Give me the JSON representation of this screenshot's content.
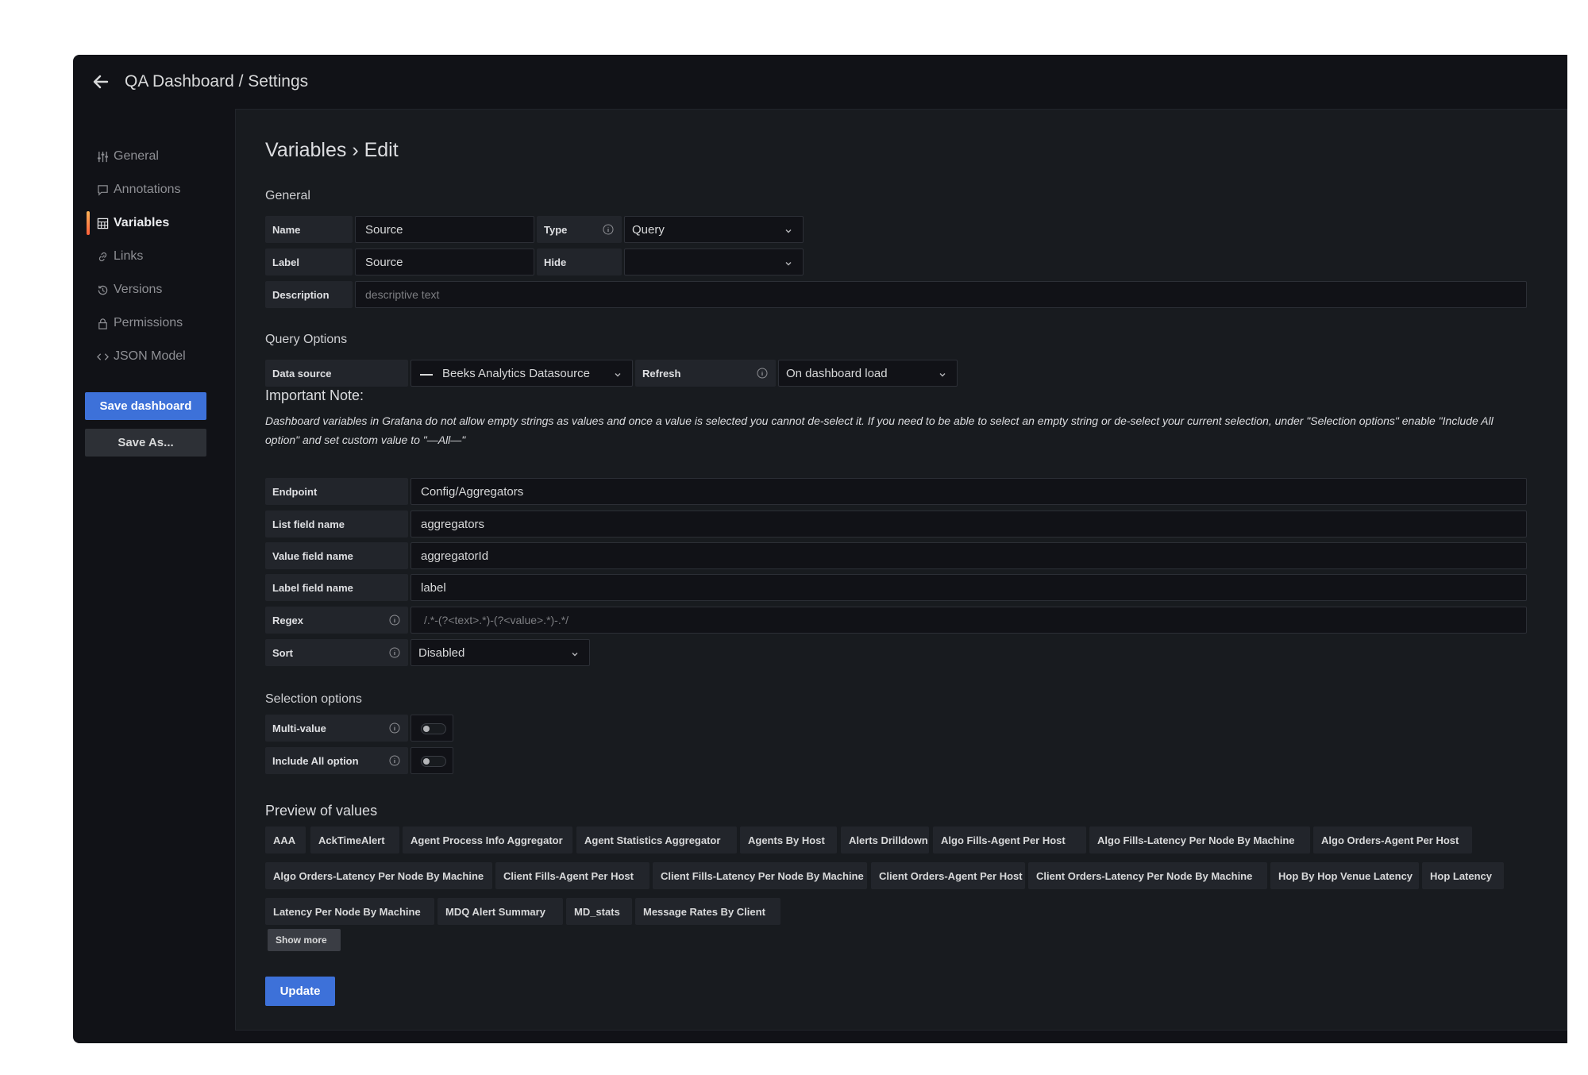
{
  "header": {
    "title": "QA Dashboard / Settings"
  },
  "sidebar": {
    "items": [
      {
        "label": "General",
        "icon": "sliders-icon"
      },
      {
        "label": "Annotations",
        "icon": "comment-icon"
      },
      {
        "label": "Variables",
        "icon": "calculator-icon",
        "active": true
      },
      {
        "label": "Links",
        "icon": "link-icon"
      },
      {
        "label": "Versions",
        "icon": "history-icon"
      },
      {
        "label": "Permissions",
        "icon": "lock-icon"
      },
      {
        "label": "JSON Model",
        "icon": "code-icon"
      }
    ],
    "save_label": "Save dashboard",
    "save_as_label": "Save As..."
  },
  "page": {
    "heading": "Variables › Edit"
  },
  "general": {
    "section": "General",
    "name_label": "Name",
    "name_value": "Source",
    "type_label": "Type",
    "type_value": "Query",
    "label_label": "Label",
    "label_value": "Source",
    "hide_label": "Hide",
    "hide_value": "",
    "description_label": "Description",
    "description_placeholder": "descriptive text"
  },
  "query": {
    "section": "Query Options",
    "datasource_label": "Data source",
    "datasource_value": "Beeks Analytics Datasource",
    "refresh_label": "Refresh",
    "refresh_value": "On dashboard load",
    "note_title": "Important Note:",
    "note_body": "Dashboard variables in Grafana do not allow empty strings as values and once a value is selected you cannot de-select it. If you need to be able to select an empty string or de-select your current selection, under \"Selection options\" enable \"Include All option\" and set custom value to \"—All—\"",
    "endpoint_label": "Endpoint",
    "endpoint_value": "Config/Aggregators",
    "listfield_label": "List field name",
    "listfield_value": "aggregators",
    "valuefield_label": "Value field name",
    "valuefield_value": "aggregatorId",
    "labelfield_label": "Label field name",
    "labelfield_value": "label",
    "regex_label": "Regex",
    "regex_placeholder": "/.*-(?<text>.*)-(?<value>.*)-.*/",
    "sort_label": "Sort",
    "sort_value": "Disabled"
  },
  "selection": {
    "section": "Selection options",
    "multi_label": "Multi-value",
    "multi_on": false,
    "includeall_label": "Include All option",
    "includeall_on": false
  },
  "preview": {
    "section": "Preview of values",
    "rows": [
      [
        "AAA",
        "AckTimeAlert",
        "Agent Process Info Aggregator",
        "Agent Statistics Aggregator",
        "Agents By Host",
        "Alerts Drilldown",
        "Algo Fills-Agent Per Host",
        "Algo Fills-Latency Per Node By Machine",
        "Algo Orders-Agent Per Host"
      ],
      [
        "Algo Orders-Latency Per Node By Machine",
        "Client Fills-Agent Per Host",
        "Client Fills-Latency Per Node By Machine",
        "Client Orders-Agent Per Host",
        "Client Orders-Latency Per Node By Machine",
        "Hop By Hop Venue Latency",
        "Hop Latency"
      ],
      [
        "Latency Per Node By Machine",
        "MDQ Alert Summary",
        "MD_stats",
        "Message Rates By Client"
      ]
    ],
    "show_more": "Show more"
  },
  "update_label": "Update",
  "colors": {
    "primary": "#3d71d9",
    "bg": "#111217",
    "panel": "#181b1f",
    "label_bg": "#22252b"
  }
}
